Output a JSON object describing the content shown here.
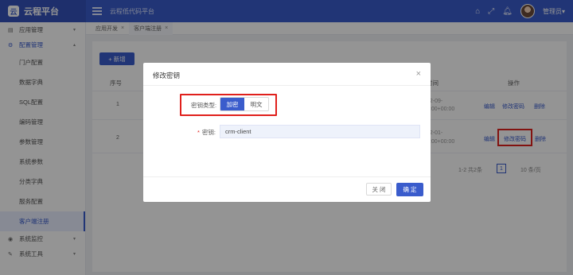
{
  "header": {
    "logo_mark": "云",
    "app_title": "云程平台",
    "subtitle": "云程低代码平台",
    "user_name": "管理员▾"
  },
  "sidebar": {
    "groups": [
      {
        "label": "应用管理",
        "arrow": "▾"
      },
      {
        "label": "配置管理",
        "arrow": "▴"
      }
    ],
    "sub_items": [
      "门户配置",
      "数据字典",
      "SQL配置",
      "编码管理",
      "参数管理",
      "系统参数",
      "分类字典",
      "服务配置",
      "客户端注册"
    ],
    "bottom_groups": [
      {
        "label": "系统监控",
        "arrow": "▾"
      },
      {
        "label": "系统工具",
        "arrow": "▾"
      }
    ]
  },
  "tabs": [
    {
      "label": "应用开发",
      "close": "×"
    },
    {
      "label": "客户端注册",
      "close": "×"
    }
  ],
  "main": {
    "add_button": "+ 新增",
    "col_seq": "序号",
    "col_time": "时间",
    "col_ops": "操作",
    "rows": [
      {
        "seq": "1",
        "time1": "22-09-",
        "time2": "2:00+00:00",
        "op_edit": "编辑",
        "op_pwd": "修改密码",
        "op_del": "删除"
      },
      {
        "seq": "2",
        "time1": "22-01-",
        "time2": "0:00+00:00",
        "op_edit": "编辑",
        "op_pwd": "修改密码",
        "op_del": "删除"
      }
    ],
    "pager_total": "1-2 共2条",
    "pager_page": "1",
    "pager_size": "10 条/页"
  },
  "dialog": {
    "title": "修改密钥",
    "close_icon": "×",
    "type_label": "密钥类型:",
    "type_encrypted": "加密",
    "type_plain": "明文",
    "key_required": "*",
    "key_label": "密钥:",
    "key_value": "crm-client",
    "btn_close": "关 闭",
    "btn_ok": "确 定"
  }
}
